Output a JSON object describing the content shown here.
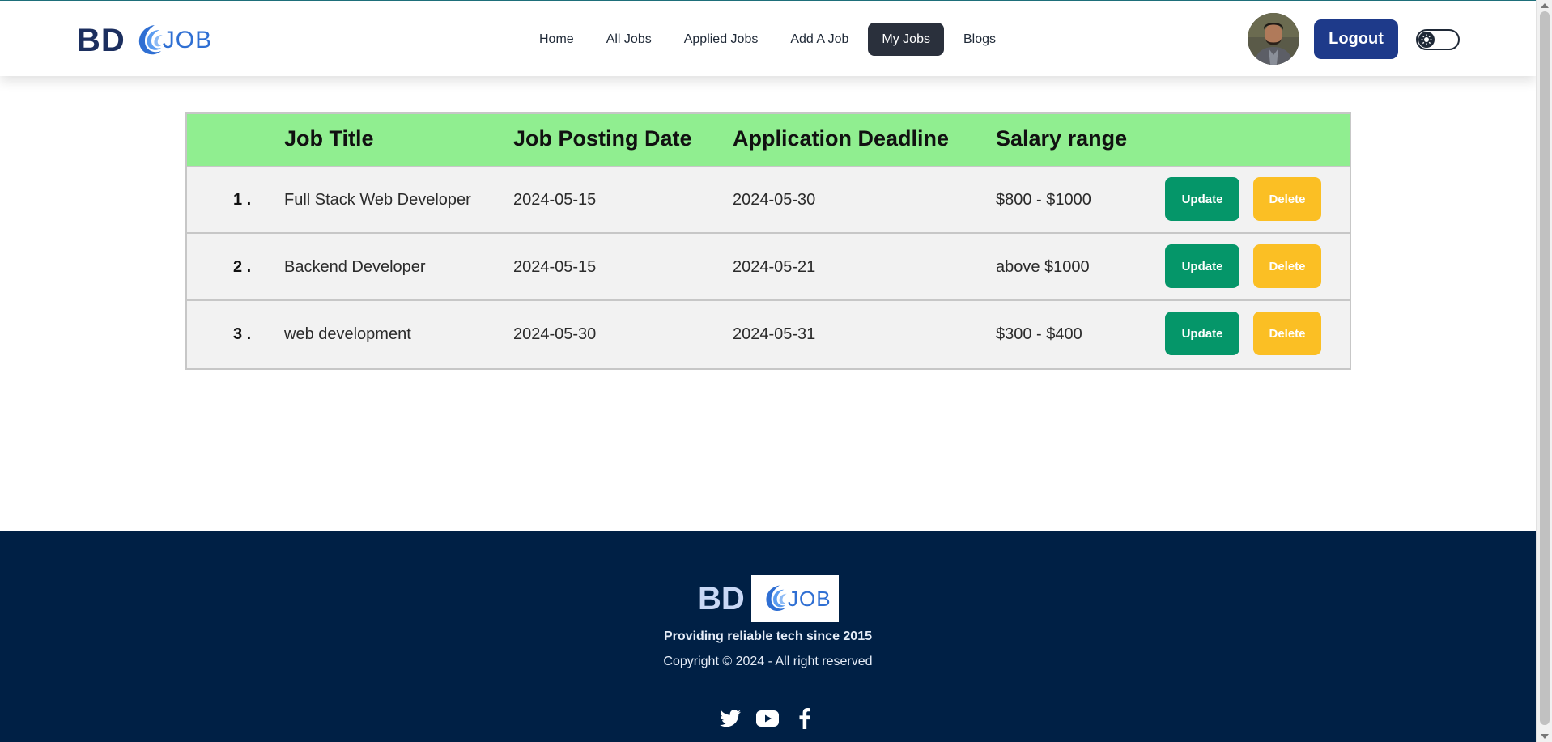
{
  "nav": {
    "logo": {
      "bd": "BD",
      "job": "JOB"
    },
    "links": [
      {
        "label": "Home"
      },
      {
        "label": "All Jobs"
      },
      {
        "label": "Applied Jobs"
      },
      {
        "label": "Add A Job"
      },
      {
        "label": "My Jobs",
        "active": true
      },
      {
        "label": "Blogs"
      }
    ],
    "logout_label": "Logout"
  },
  "table": {
    "headers": [
      "",
      "Job Title",
      "Job Posting Date",
      "Application Deadline",
      "Salary range"
    ],
    "rows": [
      {
        "num": "1 .",
        "title": "Full Stack Web Developer",
        "posted": "2024-05-15",
        "deadline": "2024-05-30",
        "salary": "$800 - $1000"
      },
      {
        "num": "2 .",
        "title": "Backend Developer",
        "posted": "2024-05-15",
        "deadline": "2024-05-21",
        "salary": "above $1000"
      },
      {
        "num": "3 .",
        "title": "web development",
        "posted": "2024-05-30",
        "deadline": "2024-05-31",
        "salary": "$300 - $400"
      }
    ],
    "update_label": "Update",
    "delete_label": "Delete"
  },
  "footer": {
    "logo": {
      "bd": "BD",
      "job": "JOB"
    },
    "tagline": "Providing reliable tech since 2015",
    "copyright": "Copyright © 2024 - All right reserved",
    "socials": [
      "twitter-icon",
      "youtube-icon",
      "facebook-icon"
    ]
  },
  "colors": {
    "brand_dark": "#1c2f5f",
    "brand_blue": "#2f6fd3",
    "logout_bg": "#1e3a8a",
    "active_nav_bg": "#2a303c",
    "table_header_bg": "#90ee90",
    "update_bg": "#059669",
    "delete_bg": "#fbbf24",
    "footer_bg": "#002045"
  }
}
